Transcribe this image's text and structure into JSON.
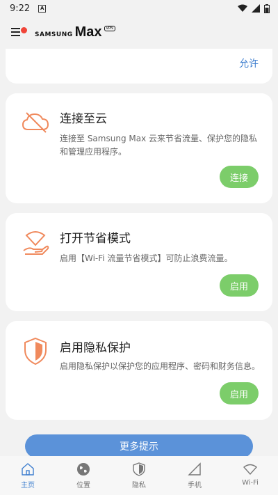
{
  "status_bar": {
    "time": "9:22",
    "notif_glyph": "A"
  },
  "header": {
    "brand_small": "SAMSUNG",
    "brand_large": "Max",
    "brand_badge": "VPN"
  },
  "top_card": {
    "action": "允许"
  },
  "cards": [
    {
      "icon": "cloud-off-icon",
      "title": "连接至云",
      "desc": "连接至 Samsung Max 云来节省流量、保护您的隐私和管理应用程序。",
      "button": "连接"
    },
    {
      "icon": "wifi-saver-icon",
      "title": "打开节省模式",
      "desc": "启用【Wi-Fi 流量节省模式】可防止浪费流量。",
      "button": "启用"
    },
    {
      "icon": "shield-icon",
      "title": "启用隐私保护",
      "desc": "启用隐私保护以保护您的应用程序、密码和财务信息。",
      "button": "启用"
    }
  ],
  "more_tips": "更多提示",
  "nav": [
    {
      "label": "主页",
      "icon": "home-icon",
      "active": true
    },
    {
      "label": "位置",
      "icon": "globe-icon",
      "active": false
    },
    {
      "label": "隐私",
      "icon": "shield-icon",
      "active": false
    },
    {
      "label": "手机",
      "icon": "cellular-icon",
      "active": false
    },
    {
      "label": "Wi-Fi",
      "icon": "wifi-icon",
      "active": false
    }
  ],
  "colors": {
    "accent": "#3f7fcf",
    "button_green": "#7ccd6a",
    "icon_orange": "#f08a5d",
    "tips_blue": "#5b92d9"
  }
}
